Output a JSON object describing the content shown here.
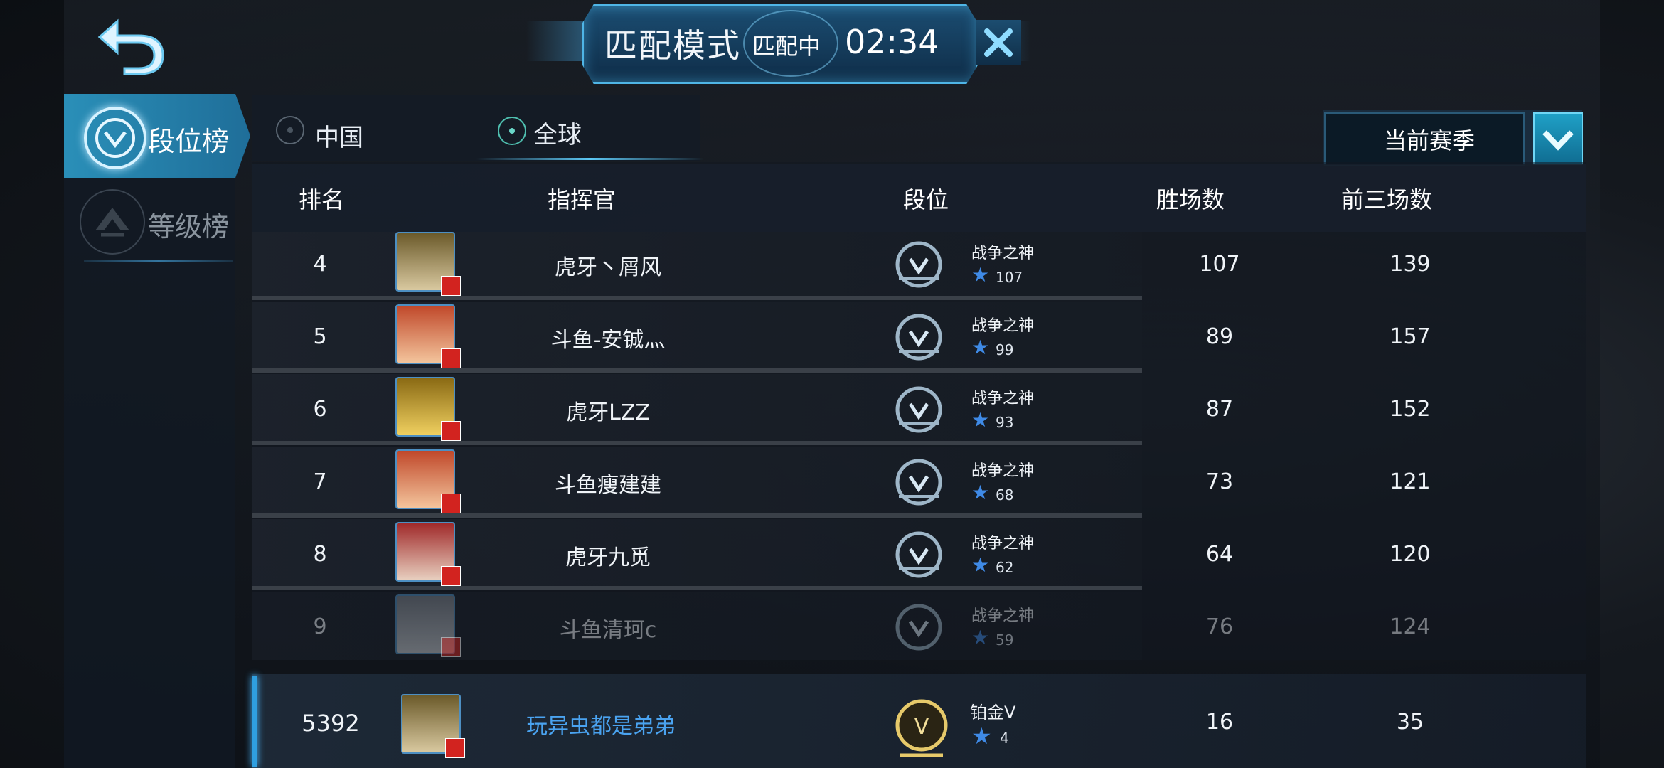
{
  "header": {
    "title": "匹配模式",
    "status": "匹配中",
    "timer": "02:34"
  },
  "sidebar": {
    "items": [
      {
        "label": "段位榜",
        "active": true
      },
      {
        "label": "等级榜",
        "active": false
      }
    ]
  },
  "filter": {
    "options": [
      {
        "label": "中国",
        "selected": false
      },
      {
        "label": "全球",
        "selected": true
      }
    ],
    "season": "当前赛季"
  },
  "table": {
    "headers": {
      "rank": "排名",
      "commander": "指挥官",
      "tier": "段位",
      "wins": "胜场数",
      "top3": "前三场数"
    },
    "rows": [
      {
        "rank": "4",
        "name": "虎牙丶屑风",
        "tier": "战争之神",
        "stars": "107",
        "wins": "107",
        "top3": "139"
      },
      {
        "rank": "5",
        "name": "斗鱼-安铖灬",
        "tier": "战争之神",
        "stars": "99",
        "wins": "89",
        "top3": "157"
      },
      {
        "rank": "6",
        "name": "虎牙LZZ",
        "tier": "战争之神",
        "stars": "93",
        "wins": "87",
        "top3": "152"
      },
      {
        "rank": "7",
        "name": "斗鱼瘦建建",
        "tier": "战争之神",
        "stars": "68",
        "wins": "73",
        "top3": "121"
      },
      {
        "rank": "8",
        "name": "虎牙九觅",
        "tier": "战争之神",
        "stars": "62",
        "wins": "64",
        "top3": "120"
      },
      {
        "rank": "9",
        "name": "斗鱼清珂c",
        "tier": "战争之神",
        "stars": "59",
        "wins": "76",
        "top3": "124"
      }
    ]
  },
  "me": {
    "rank": "5392",
    "name": "玩异虫都是弟弟",
    "tier": "铂金V",
    "stars": "4",
    "wins": "16",
    "top3": "35"
  },
  "colors": {
    "accent": "#2f9fe0",
    "my_name": "#4aa3f0",
    "star": "#3f8ae6",
    "flag": "#d2231f"
  }
}
